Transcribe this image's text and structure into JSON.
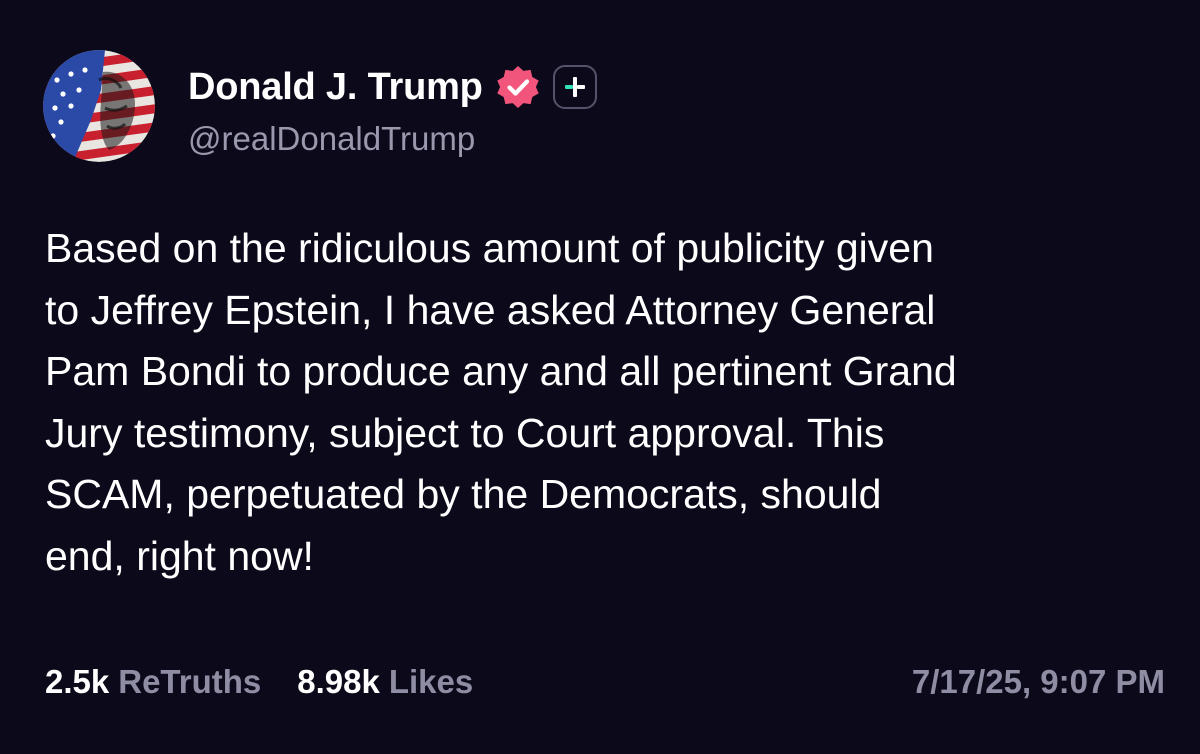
{
  "author": {
    "display_name": "Donald J. Trump",
    "handle": "@realDonaldTrump",
    "verified_icon": "verified-badge-icon",
    "plus_icon": "plus-badge-icon",
    "avatar_icon": "flag-portrait-avatar"
  },
  "post": {
    "lines": [
      "Based on the ridiculous amount of publicity given",
      "to Jeffrey Epstein, I have asked Attorney General",
      "Pam Bondi to produce any and all pertinent Grand",
      "Jury testimony, subject to Court approval. This",
      "SCAM, perpetuated by the Democrats, should",
      "end, right now!"
    ]
  },
  "stats": {
    "retruths_count": "2.5k",
    "retruths_label": "ReTruths",
    "likes_count": "8.98k",
    "likes_label": "Likes"
  },
  "timestamp": "7/17/25, 9:07 PM",
  "colors": {
    "background": "#0c0a1a",
    "verified_badge": "#f2557c",
    "plus_accent": "#35e0b4",
    "muted_text": "#8f8da3"
  }
}
